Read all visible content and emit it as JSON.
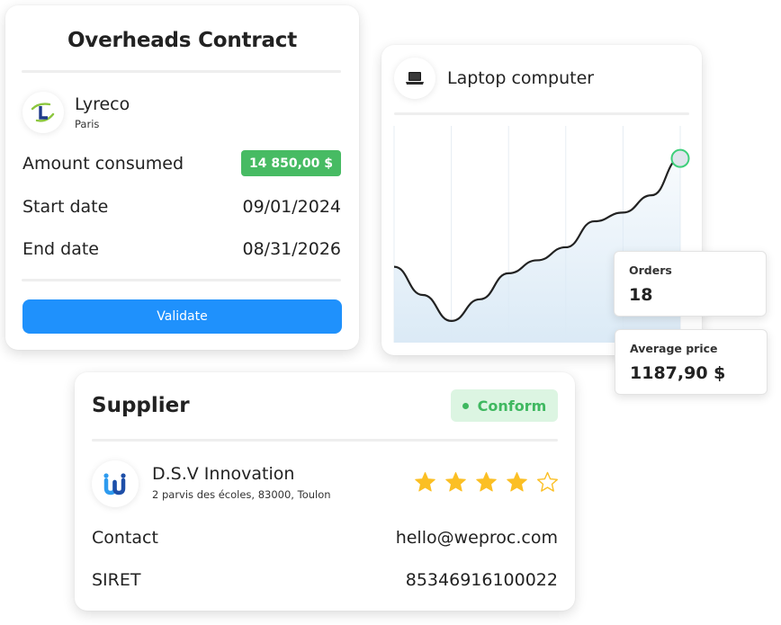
{
  "contract": {
    "title": "Overheads Contract",
    "company": {
      "name": "Lyreco",
      "city": "Paris",
      "logo_icon": "lyreco-logo-icon"
    },
    "amount_consumed": {
      "label": "Amount consumed",
      "value": "14 850,00 $",
      "badge_color": "#47bb63"
    },
    "start_date": {
      "label": "Start date",
      "value": "09/01/2024"
    },
    "end_date": {
      "label": "End date",
      "value": "08/31/2026"
    },
    "validate_label": "Validate",
    "accent_color": "#1f91fc"
  },
  "product": {
    "name": "Laptop computer",
    "icon": "laptop-icon",
    "stats": {
      "orders": {
        "label": "Orders",
        "value": "18"
      },
      "average_price": {
        "label": "Average price",
        "value": "1187,90 $"
      }
    }
  },
  "chart_data": {
    "type": "line",
    "title": "Laptop computer",
    "xlabel": "",
    "ylabel": "",
    "x": [
      0,
      0.5,
      1,
      1.5,
      2,
      2.5,
      3,
      3.5,
      4,
      4.5,
      5
    ],
    "values": [
      35,
      22,
      10,
      20,
      32,
      38,
      44,
      56,
      60,
      68,
      85
    ],
    "xlim": [
      0,
      5
    ],
    "ylim": [
      0,
      100
    ],
    "vertical_gridlines": 6,
    "grid": true,
    "area_fill": true,
    "highlight_last_point": true,
    "line_color": "#222222",
    "marker_color": "#3ecf7a",
    "fill_color": "#dbeaf6"
  },
  "supplier": {
    "title": "Supplier",
    "status": {
      "label": "Conform",
      "color": "#3fb860"
    },
    "name": "D.S.V Innovation",
    "address": "2 parvis des écoles, 83000, Toulon",
    "logo_icon": "weproc-logo-icon",
    "rating": {
      "value": 4,
      "max": 5
    },
    "contact": {
      "label": "Contact",
      "value": "hello@weproc.com"
    },
    "siret": {
      "label": "SIRET",
      "value": "85346916100022"
    }
  }
}
